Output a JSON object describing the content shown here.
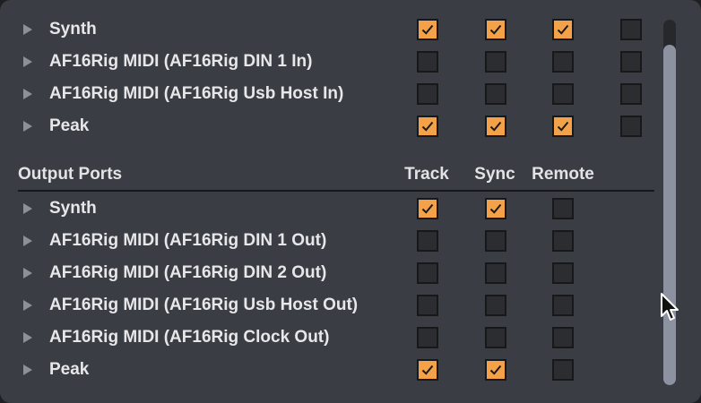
{
  "input_ports": [
    {
      "name": "Synth",
      "checks": [
        true,
        true,
        true,
        false
      ]
    },
    {
      "name": "AF16Rig MIDI (AF16Rig DIN 1 In)",
      "checks": [
        false,
        false,
        false,
        false
      ]
    },
    {
      "name": "AF16Rig MIDI (AF16Rig Usb Host In)",
      "checks": [
        false,
        false,
        false,
        false
      ]
    },
    {
      "name": "Peak",
      "checks": [
        true,
        true,
        true,
        false
      ]
    }
  ],
  "output_section": {
    "title": "Output Ports",
    "col_track": "Track",
    "col_sync": "Sync",
    "col_remote": "Remote"
  },
  "output_ports": [
    {
      "name": "Synth",
      "checks": [
        true,
        true,
        false
      ]
    },
    {
      "name": "AF16Rig MIDI (AF16Rig DIN 1 Out)",
      "checks": [
        false,
        false,
        false
      ]
    },
    {
      "name": "AF16Rig MIDI (AF16Rig DIN 2 Out)",
      "checks": [
        false,
        false,
        false
      ]
    },
    {
      "name": "AF16Rig MIDI (AF16Rig Usb Host Out)",
      "checks": [
        false,
        false,
        false
      ]
    },
    {
      "name": "AF16Rig MIDI (AF16Rig Clock Out)",
      "checks": [
        false,
        false,
        false
      ]
    },
    {
      "name": "Peak",
      "checks": [
        true,
        true,
        false
      ]
    }
  ],
  "colors": {
    "accent": "#f4a24a",
    "panel": "#3a3d43"
  }
}
